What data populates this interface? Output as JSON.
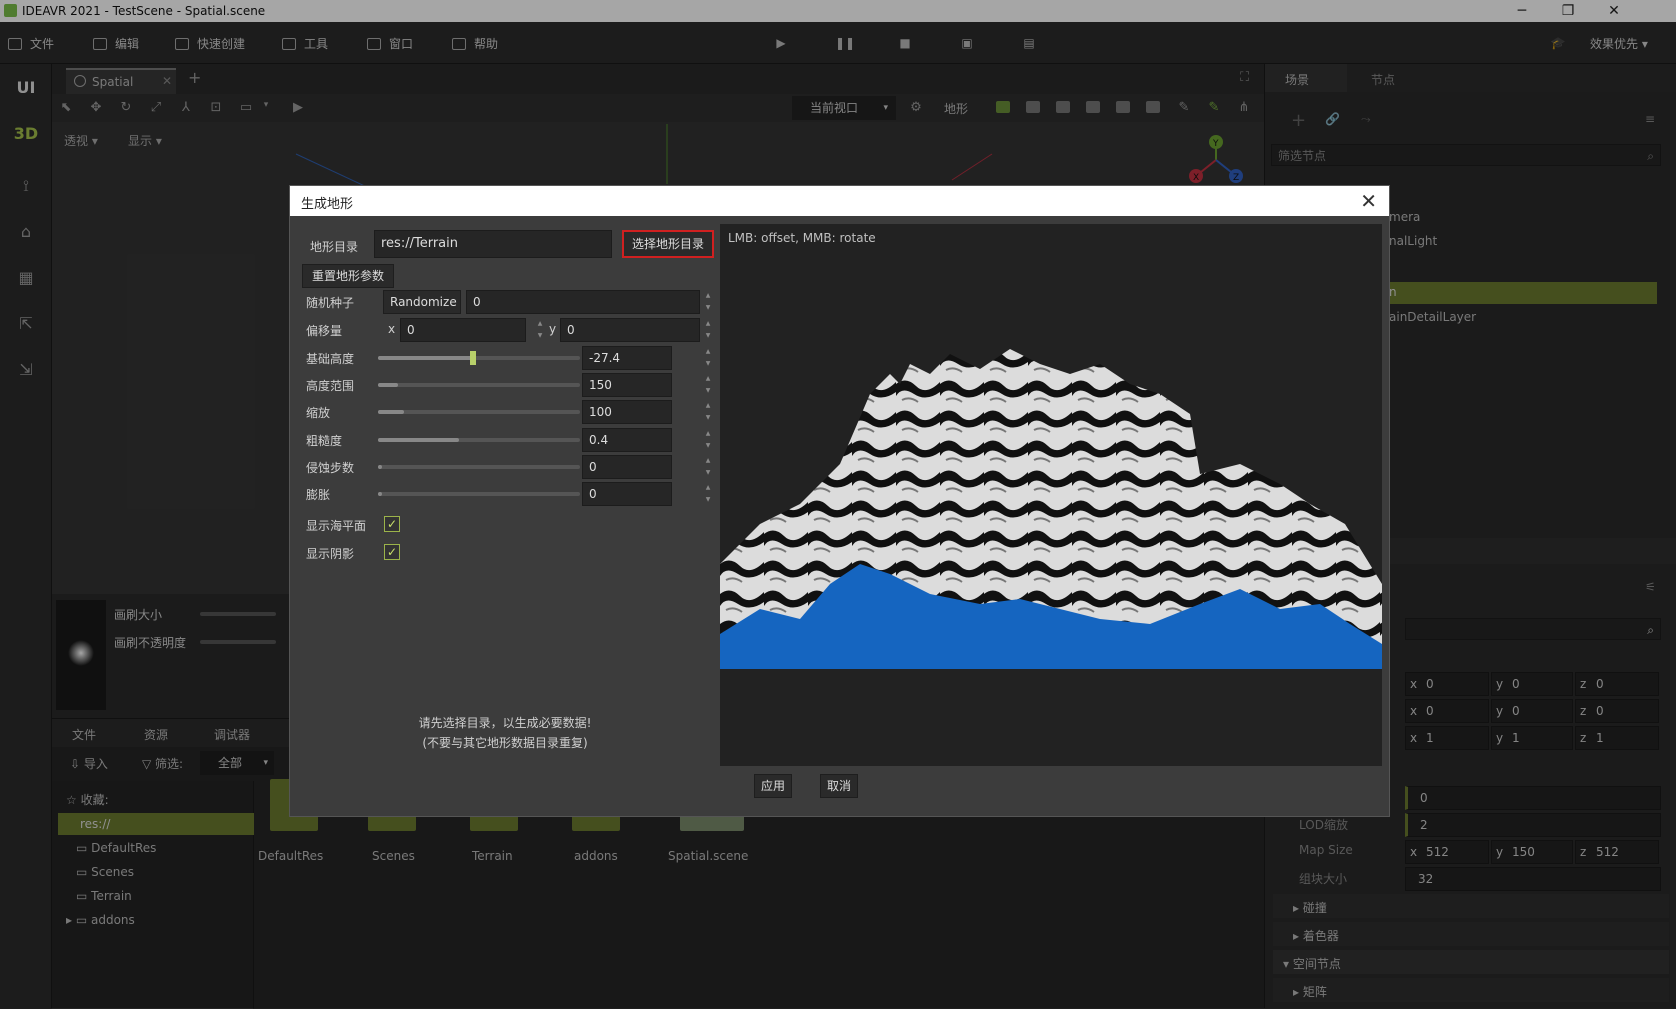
{
  "window": {
    "title": "IDEAVR 2021 - TestScene - Spatial.scene"
  },
  "menu": [
    {
      "label": "文件",
      "icon": "folder-icon"
    },
    {
      "label": "编辑",
      "icon": "crop-icon"
    },
    {
      "label": "快速创建",
      "icon": "edit-icon"
    },
    {
      "label": "工具",
      "icon": "toolbox-icon"
    },
    {
      "label": "窗口",
      "icon": "window-icon"
    },
    {
      "label": "帮助",
      "icon": "help-icon"
    }
  ],
  "quality_label": "效果优先",
  "left_tabs": [
    "UI",
    "3D"
  ],
  "viewport": {
    "tab": "Spatial",
    "view_mode": "透视",
    "display": "显示",
    "camera_select": "当前视口",
    "terrain_label": "地形"
  },
  "brush": {
    "size_label": "画刷大小",
    "opacity_label": "画刷不透明度"
  },
  "bottom": {
    "tabs": [
      "文件",
      "资源",
      "调试器"
    ],
    "import_label": "导入",
    "filter_label": "筛选:",
    "filter_value": "全部",
    "favorites": "收藏:",
    "tree": [
      "res://",
      "DefaultRes",
      "Scenes",
      "Terrain",
      "addons"
    ],
    "files": [
      "DefaultRes",
      "Scenes",
      "Terrain",
      "addons",
      "Spatial.scene"
    ]
  },
  "right": {
    "tabs": [
      "场景",
      "节点"
    ],
    "filter_placeholder": "筛选节点",
    "nodes": [
      "mera",
      "nalLight",
      "n",
      "ainDetailLayer"
    ],
    "transform_rows": [
      {
        "x": "0",
        "y": "0",
        "z": "0"
      },
      {
        "x": "0",
        "y": "0",
        "z": "0"
      },
      {
        "x": "1",
        "y": "1",
        "z": "1"
      }
    ],
    "lod_value": "0",
    "lod_scale_label": "LOD缩放",
    "lod_scale_value": "2",
    "map_size_label": "Map Size",
    "map_size": {
      "x": "512",
      "y": "150",
      "z": "512"
    },
    "chunk_label": "组块大小",
    "chunk_value": "32",
    "sections": [
      "碰撞",
      "着色器",
      "空间节点",
      "矩阵"
    ]
  },
  "dialog": {
    "title": "生成地形",
    "dir_label": "地形目录",
    "dir_value": "res://Terrain",
    "select_dir_btn": "选择地形目录",
    "reset_btn": "重置地形参数",
    "seed_label": "随机种子",
    "randomize_btn": "Randomize",
    "seed_value": "0",
    "offset_label": "偏移量",
    "offset_x": "0",
    "offset_y": "0",
    "params": [
      {
        "label": "基础高度",
        "value": "-27.4",
        "fraction": 0.47
      },
      {
        "label": "高度范围",
        "value": "150",
        "fraction": 0.1
      },
      {
        "label": "缩放",
        "value": "100",
        "fraction": 0.13
      },
      {
        "label": "粗糙度",
        "value": "0.4",
        "fraction": 0.4
      },
      {
        "label": "侵蚀步数",
        "value": "0",
        "fraction": 0.02
      },
      {
        "label": "膨胀",
        "value": "0",
        "fraction": 0.02
      }
    ],
    "show_sea_label": "显示海平面",
    "show_shadow_label": "显示阴影",
    "note_line1": "请先选择目录，以生成必要数据!",
    "note_line2": "(不要与其它地形数据目录重复)",
    "preview_hint": "LMB: offset, MMB: rotate",
    "apply_btn": "应用",
    "cancel_btn": "取消"
  },
  "colors": {
    "accent": "#6b7a2e",
    "sea": "#1565c0",
    "highlight_border": "#d02020"
  }
}
